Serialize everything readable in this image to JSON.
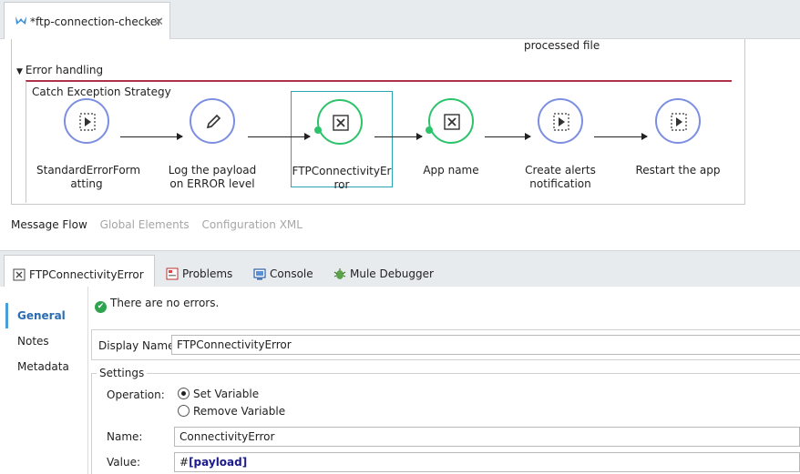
{
  "editor": {
    "tab_title": "*ftp-connection-checker",
    "tab_close": "✕"
  },
  "canvas": {
    "partial_label": "processed file",
    "section_title": "Error handling",
    "strategy_title": "Catch Exception Strategy",
    "nodes": [
      {
        "label": "StandardErrorFormatting",
        "icon": "flow-ref-icon",
        "style": "blue"
      },
      {
        "label": "Log the payload on ERROR level",
        "icon": "logger-pencil-icon",
        "style": "blue"
      },
      {
        "label": "FTPConnectivityError",
        "icon": "variable-x-icon",
        "style": "green",
        "selected": true
      },
      {
        "label": "App name",
        "icon": "variable-x-icon",
        "style": "green"
      },
      {
        "label": "Create alerts notification",
        "icon": "flow-ref-icon",
        "style": "blue"
      },
      {
        "label": "Restart the app",
        "icon": "flow-ref-icon",
        "style": "blue"
      }
    ],
    "view_tabs": [
      "Message Flow",
      "Global Elements",
      "Configuration XML"
    ],
    "active_view_tab": "Message Flow"
  },
  "props_tabs": [
    {
      "label": "FTPConnectivityError",
      "icon": "variable-x-icon",
      "active": true
    },
    {
      "label": "Problems",
      "icon": "problems-icon"
    },
    {
      "label": "Console",
      "icon": "console-icon"
    },
    {
      "label": "Mule Debugger",
      "icon": "debugger-bug-icon"
    }
  ],
  "props": {
    "status_text": "There are no errors.",
    "side_nav": [
      "General",
      "Notes",
      "Metadata"
    ],
    "active_nav": "General",
    "display_name_label": "Display Name:",
    "display_name_value": "FTPConnectivityError",
    "settings_label": "Settings",
    "operation_label": "Operation:",
    "op_set": "Set Variable",
    "op_remove": "Remove Variable",
    "name_label": "Name:",
    "name_value": "ConnectivityError",
    "value_label": "Value:",
    "value_hash": "#",
    "value_expr": "[payload]"
  },
  "colors": {
    "accent_blue": "#7c8fe0",
    "accent_green": "#2cc36b",
    "strategy_bar": "#b0324a",
    "selection": "#2aa5b4"
  }
}
